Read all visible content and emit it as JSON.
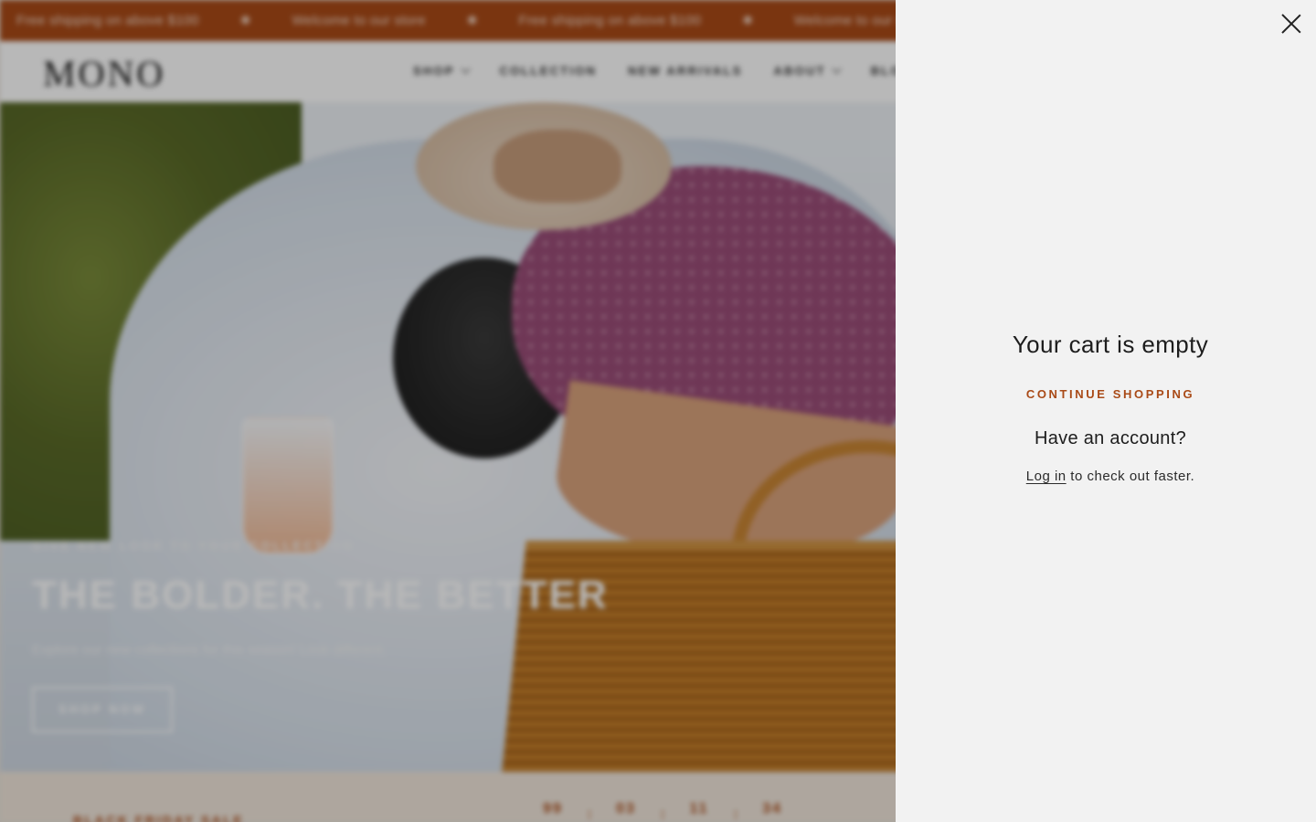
{
  "announcement": {
    "messages": [
      "Free shipping on above $100",
      "Welcome to our store",
      "Free shipping on above $100",
      "Welcome to our store"
    ],
    "separator": "✱"
  },
  "header": {
    "logo": "MONO",
    "nav": [
      "SHOP",
      "COLLECTION",
      "NEW ARRIVALS",
      "ABOUT",
      "BLOG"
    ]
  },
  "hero": {
    "kicker": "GIVE NEW LOOK TO YOUR COLLECTION",
    "title": "THE BOLDER. THE BETTER",
    "subtitle": "Explore our new collections for this season! Look different.",
    "button": "SHOP NOW"
  },
  "promo": {
    "label": "BLACK FRIDAY SALE",
    "countdown": [
      "99",
      "03",
      "11",
      "34"
    ],
    "separator": ":"
  },
  "cart": {
    "empty_title": "Your cart is empty",
    "continue_label": "CONTINUE SHOPPING",
    "account_title": "Have an account?",
    "login_link": "Log in",
    "login_suffix": " to check out faster."
  },
  "colors": {
    "accent": "#a94a17",
    "drawer_bg": "#f2f2f2"
  },
  "icons": {
    "close": "close-icon",
    "nav_dropdown": "chevron-down-icon"
  }
}
